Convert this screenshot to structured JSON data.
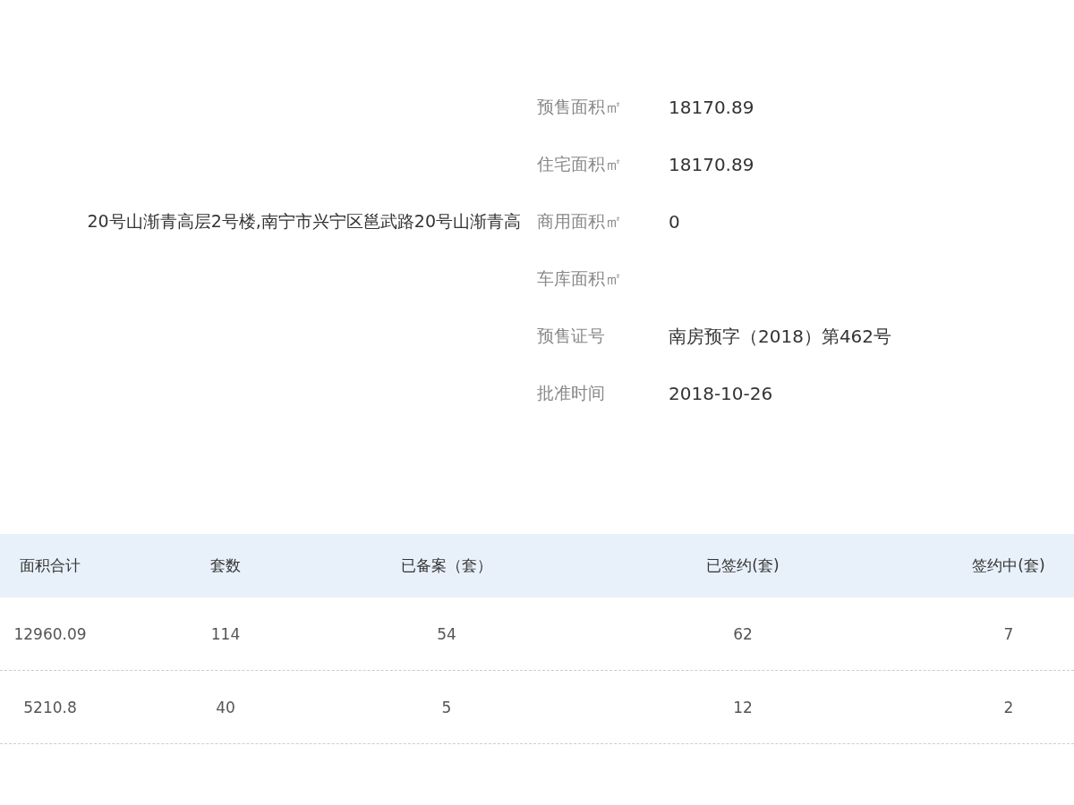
{
  "address": "20号山渐青高层2号楼,南宁市兴宁区邕武路20号山渐青高",
  "details": [
    {
      "label": "预售面积㎡",
      "value": "18170.89"
    },
    {
      "label": "住宅面积㎡",
      "value": "18170.89"
    },
    {
      "label": "商用面积㎡",
      "value": "0"
    },
    {
      "label": "车库面积㎡"
    },
    {
      "label": "预售证号",
      "value": "南房预字（2018）第462号"
    },
    {
      "label": "批准时间",
      "value": "2018-10-26"
    }
  ],
  "table": {
    "columns": [
      "面积合计",
      "套数",
      "已备案（套）",
      "已签约(套)",
      "签约中(套)"
    ],
    "rows": [
      [
        "12960.09",
        "114",
        "54",
        "62",
        "7"
      ],
      [
        "5210.8",
        "40",
        "5",
        "12",
        "2"
      ]
    ]
  }
}
